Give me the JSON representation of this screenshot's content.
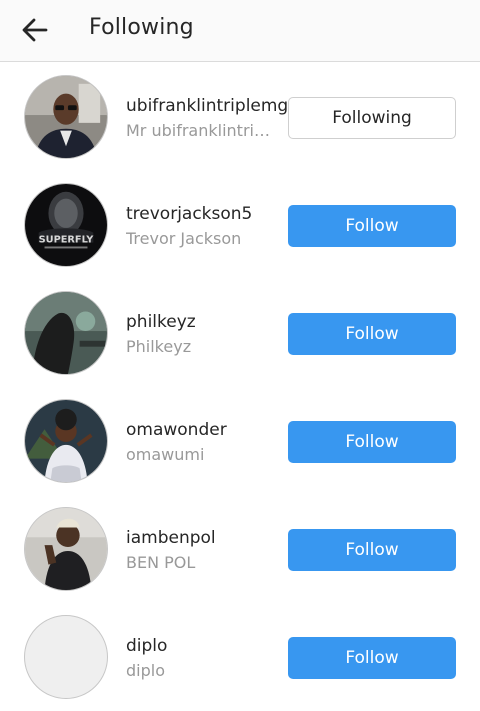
{
  "header": {
    "title": "Following",
    "back_icon": "arrow-left-icon"
  },
  "colors": {
    "follow_button": "#3897f0",
    "username": "#262626",
    "fullname": "#999999"
  },
  "users": [
    {
      "username": "ubifranklintriplemg",
      "full_name": "Mr ubifranklintripl...",
      "button": "Following",
      "state": "following"
    },
    {
      "username": "trevorjackson5",
      "full_name": "Trevor Jackson",
      "button": "Follow",
      "state": "follow",
      "avatar_text": "SUPERFLY"
    },
    {
      "username": "philkeyz",
      "full_name": "Philkeyz",
      "button": "Follow",
      "state": "follow"
    },
    {
      "username": "omawonder",
      "full_name": "omawumi",
      "button": "Follow",
      "state": "follow"
    },
    {
      "username": "iambenpol",
      "full_name": "BEN POL",
      "button": "Follow",
      "state": "follow"
    },
    {
      "username": "diplo",
      "full_name": "diplo",
      "button": "Follow",
      "state": "follow"
    }
  ]
}
